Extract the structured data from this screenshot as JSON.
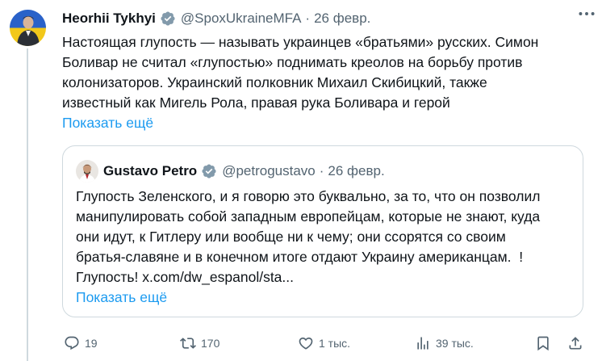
{
  "tweet": {
    "author_name": "Heorhii Tykhyi",
    "handle": "@SpoxUkraineMFA",
    "dot": "·",
    "date": "26 февр.",
    "text": "Настоящая глупость — называть украинцев «братьями» русских. Симон\nБоливар не считал «глупостью» поднимать креолов на борьбу против\nколонизаторов. Украинский полковник Михаил Скибицкий, также\nизвестный как Мигель Рола, правая рука Боливара и герой",
    "show_more": "Показать ещё"
  },
  "quote": {
    "author_name": "Gustavo Petro",
    "handle": "@petrogustavo",
    "dot": "·",
    "date": "26 февр.",
    "text": "Глупость Зеленского, и я говорю это буквально, за то, что он позволил\nманипулировать собой западным европейцам, которые не знают, куда\nони идут, к Гитлеру или вообще ни к чему; они ссорятся со своим\nбратья-славяне и в конечном итоге отдают Украину американцам.  !\nГлупость! x.com/dw_espanol/sta...",
    "show_more": "Показать ещё"
  },
  "actions": {
    "replies": "19",
    "reposts": "170",
    "likes": "1 тыс.",
    "views": "39 тыс."
  },
  "colors": {
    "accent": "#1d9bf0",
    "verified": "#829aab",
    "secondary_text": "#536471",
    "border": "#cfd9de"
  },
  "icons": [
    "verified-badge-icon",
    "more-icon",
    "reply-icon",
    "repost-icon",
    "like-icon",
    "views-icon",
    "bookmark-icon",
    "share-icon"
  ]
}
